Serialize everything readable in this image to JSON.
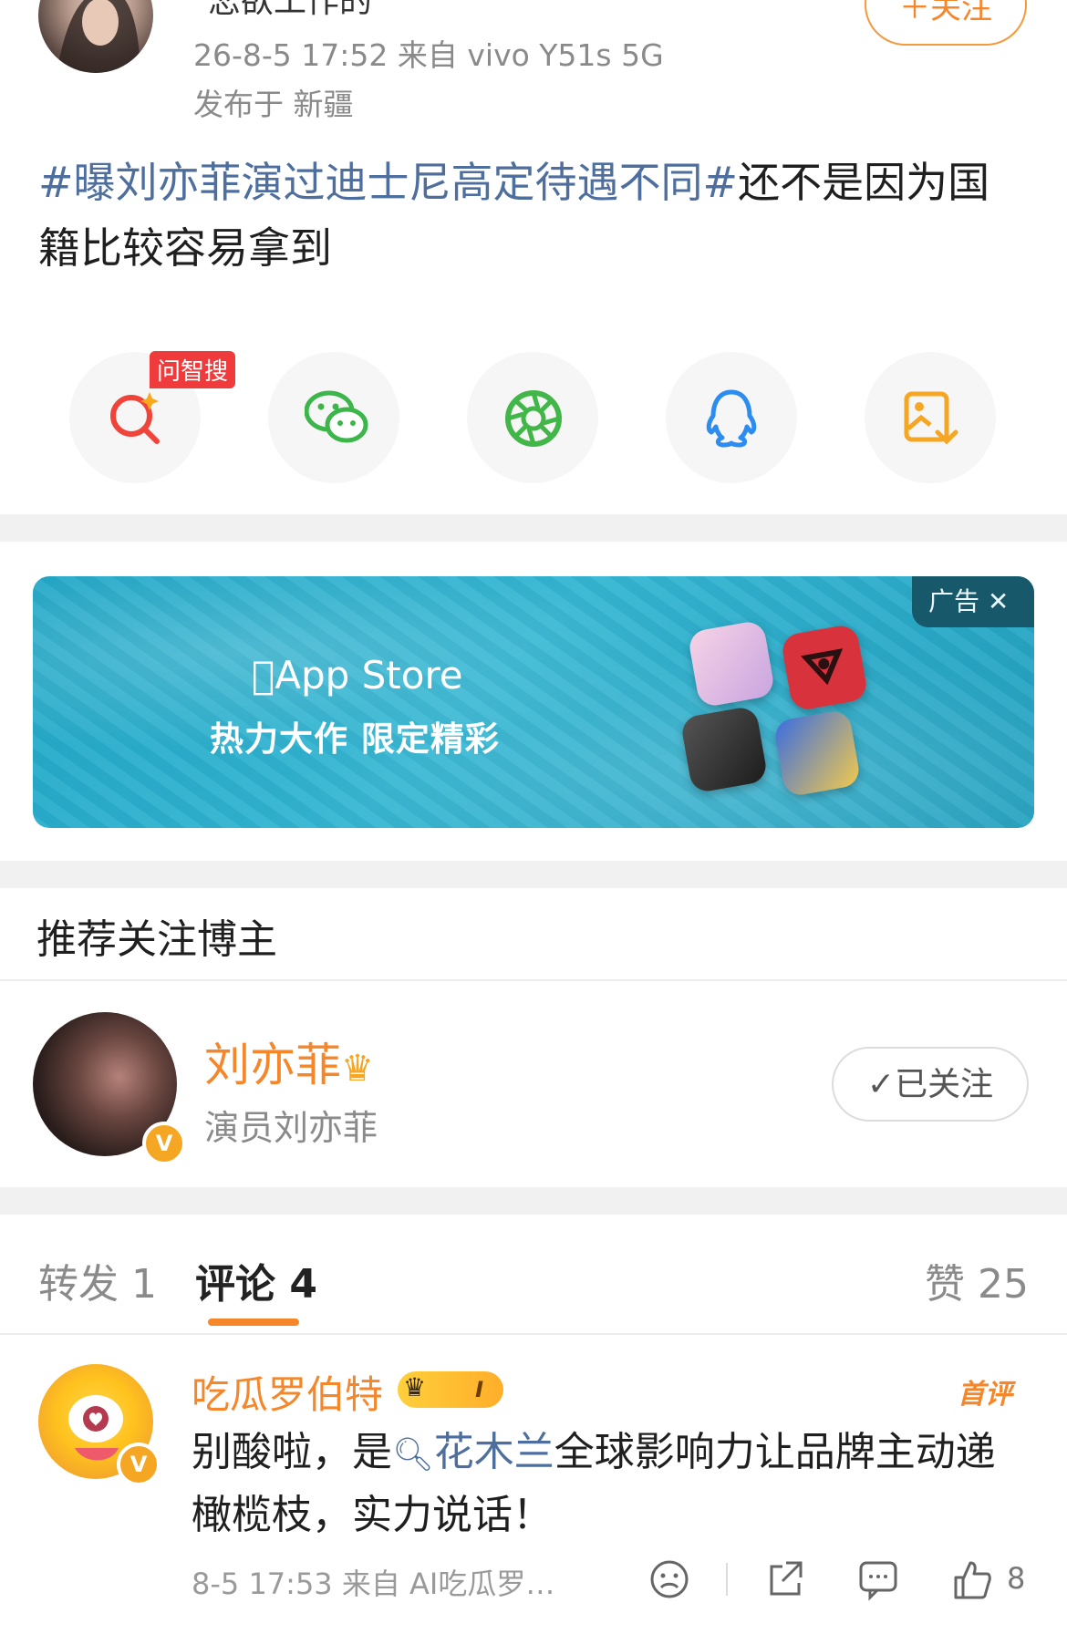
{
  "post": {
    "username": "恋欲工作的",
    "follow_label": "＋关注",
    "meta_time_source": "26-8-5 17:52  来自 vivo Y51s 5G",
    "meta_location": "发布于 新疆",
    "topic": "#曝刘亦菲演过迪士尼高定待遇不同#",
    "text": "还不是因为国籍比较容易拿到"
  },
  "share": {
    "ask_badge": "问智搜",
    "icons": [
      "ask-search-icon",
      "wechat-icon",
      "moments-icon",
      "qq-icon",
      "save-image-icon"
    ]
  },
  "ad": {
    "store_name": "App Store",
    "slogan": "热力大作 限定精彩",
    "label": "广告"
  },
  "recommend": {
    "title": "推荐关注博主",
    "name": "刘亦菲",
    "desc": "演员刘亦菲",
    "verified_badge": "V",
    "followed_label": "✓已关注"
  },
  "tabs": {
    "repost": "转发 1",
    "comment": "评论 4",
    "like": "赞 25"
  },
  "comment": {
    "name": "吃瓜罗伯特",
    "level": "I",
    "first_tag": "首评",
    "verified_badge": "V",
    "text_before": "别酸啦，是",
    "link": "花木兰",
    "text_after": "全球影响力让品牌主动递橄榄枝，实力说话！",
    "meta": "8-5 17:53  来自 AI吃瓜罗…",
    "like_count": "8"
  },
  "colors": {
    "accent": "#f5862a",
    "link": "#4e6e9e",
    "separator": "#f1f1f1"
  }
}
